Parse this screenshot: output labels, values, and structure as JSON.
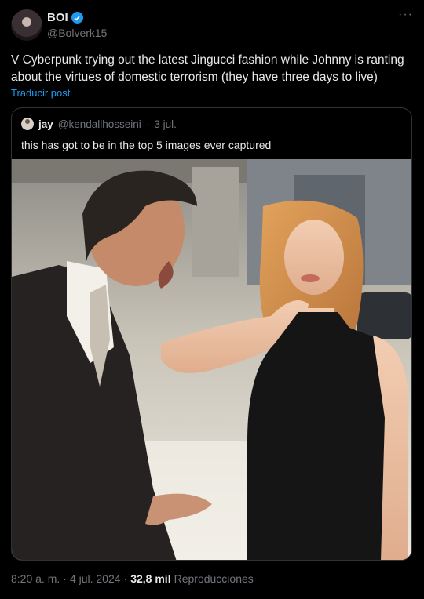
{
  "author": {
    "name": "BOI",
    "handle": "@Bolverk15",
    "verified": true,
    "avatar_icon": "profile-avatar"
  },
  "tweet": {
    "text": "V Cyberpunk trying out the latest Jingucci fashion while Johnny is ranting about the virtues of domestic terrorism (they have three days to live)",
    "translate_label": "Traducir post"
  },
  "quoted": {
    "name": "jay",
    "handle": "@kendallhosseini",
    "separator": "·",
    "date": "3 jul.",
    "text": "this has got to be in the top 5 images ever captured"
  },
  "footer": {
    "time": "8:20 a. m.",
    "separator": "·",
    "date": "4 jul. 2024",
    "separator2": "·",
    "views_count": "32,8 mil",
    "views_label": "Reproducciones"
  },
  "colors": {
    "background": "#000000",
    "text": "#e7e9ea",
    "muted": "#71767b",
    "accent": "#1d9bf0",
    "border": "#2f3336"
  }
}
